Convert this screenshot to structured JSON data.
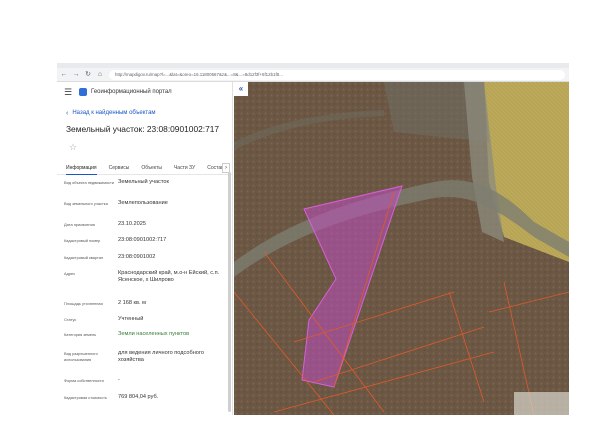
{
  "browser": {
    "url": "http://mapdigov.ru/map?l=...&lat=&oreo=16.11800667&z&...=8&...=8d12f3f+5f12b1f8..."
  },
  "app": {
    "title": "Геоинформационный портал"
  },
  "panel": {
    "back_label": "Назад к найденным объектам",
    "object_title": "Земельный участок: 23:08:0901002:717",
    "tabs": [
      "Информация",
      "Сервисы",
      "Объекты",
      "Части ЗУ",
      "Состав"
    ],
    "active_tab": 0,
    "rows": [
      {
        "label": "Вид объекта недвижимости",
        "value": "Земельный участок"
      },
      {
        "label": "Вид земельного участка",
        "value": "Землепользование"
      },
      {
        "label": "Дата присвоения",
        "value": "23.10.2025"
      },
      {
        "label": "Кадастровый номер",
        "value": "23:08:0901002:717"
      },
      {
        "label": "Кадастровый квартал",
        "value": "23:08:0901002"
      },
      {
        "label": "Адрес",
        "value": "Краснодарский край, м.о-н Ейский, с.п. Ясенское, х Шилрово"
      },
      {
        "label": "Площадь уточненная",
        "value": "2 168 кв. м"
      },
      {
        "label": "Статус",
        "value": "Учтенный"
      },
      {
        "label": "Категория земель",
        "value": "Земли населенных пунктов",
        "green": true
      },
      {
        "label": "Вид разрешенного использования",
        "value": "для ведения личного подсобного хозяйства"
      },
      {
        "label": "Форма собственности",
        "value": "-"
      },
      {
        "label": "Кадастровая стоимость",
        "value": "769 804,04 руб."
      }
    ]
  },
  "map": {
    "collapse_icon": "«",
    "colors": {
      "soil": "#6d5a46",
      "field": "#b8a55a",
      "road": "#8c8c82",
      "parcel": "#c04fc0",
      "boundary": "#e05a2a"
    }
  }
}
